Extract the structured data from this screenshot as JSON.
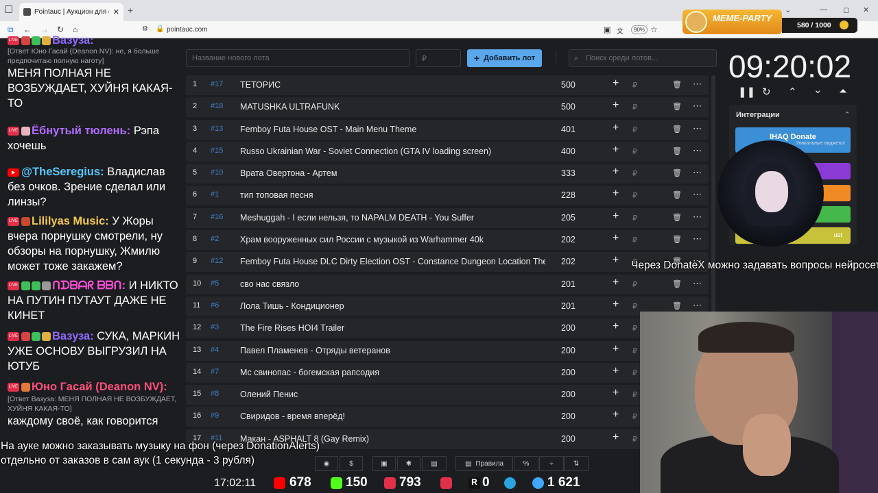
{
  "browser": {
    "tab_title": "Pointauc | Аукцион для стриме",
    "url": "pointauc.com",
    "zoom": "90%"
  },
  "toolbar": {
    "new_lot_placeholder": "Название нового лота",
    "currency_placeholder": "₽",
    "add_lot_label": "Добавить лот",
    "search_placeholder": "Поиск среди лотов..."
  },
  "lots": [
    {
      "index": "1",
      "id": "#17",
      "name": "ТЕТОРИС",
      "amount": "500"
    },
    {
      "index": "2",
      "id": "#18",
      "name": "MATUSHKA ULTRAFUNK",
      "amount": "500"
    },
    {
      "index": "3",
      "id": "#13",
      "name": "Femboy Futa House OST - Main Menu Theme",
      "amount": "401"
    },
    {
      "index": "4",
      "id": "#15",
      "name": "Russo Ukrainian War - Soviet Connection (GTA IV loading screen)",
      "amount": "400"
    },
    {
      "index": "5",
      "id": "#10",
      "name": "Врата Овертона - Артем",
      "amount": "333"
    },
    {
      "index": "6",
      "id": "#1",
      "name": "тип топовая песня",
      "amount": "228"
    },
    {
      "index": "7",
      "id": "#16",
      "name": "Meshuggah - I если нельзя, то NAPALM DEATH - You Suffer",
      "amount": "205"
    },
    {
      "index": "8",
      "id": "#2",
      "name": "Храм вооруженных сил России с музыкой из Warhammer 40k",
      "amount": "202"
    },
    {
      "index": "9",
      "id": "#12",
      "name": "Femboy Futa House DLC Dirty Election OST - Constance Dungeon Location The",
      "amount": "202"
    },
    {
      "index": "10",
      "id": "#5",
      "name": "сво нас связло",
      "amount": "201"
    },
    {
      "index": "11",
      "id": "#6",
      "name": "Лола Тишь - Кондиционер",
      "amount": "201"
    },
    {
      "index": "12",
      "id": "#3",
      "name": "The Fire Rises HOI4 Trailer",
      "amount": "200"
    },
    {
      "index": "13",
      "id": "#4",
      "name": "Павел Пламенев - Отряды ветеранов",
      "amount": "200"
    },
    {
      "index": "14",
      "id": "#7",
      "name": "Мс свинопас - богемская рапсодия",
      "amount": "200"
    },
    {
      "index": "15",
      "id": "#8",
      "name": "Олений Пенис",
      "amount": "200"
    },
    {
      "index": "16",
      "id": "#9",
      "name": "Свиридов - время вперёд!",
      "amount": "200"
    },
    {
      "index": "17",
      "id": "#11",
      "name": "Макан - ASPHALT 8 (Gay Remix)",
      "amount": "200"
    }
  ],
  "timer": {
    "value": "09:20:02"
  },
  "integrations": {
    "title": "Интеграции",
    "donate_label": "IHAQ Donate",
    "donate_sub": "Уникальные виджеты!",
    "extra_label": "uet"
  },
  "meme_party": {
    "title": "MEME-PARTY",
    "progress": "580 / 1000"
  },
  "chat": [
    {
      "user": "Вазуза:",
      "user_color": "#8d6bff",
      "text": ""
    },
    {
      "reply": "[Ответ Юно Гасай (Deanon NV): не, я больше предпочитаю полную наготу]",
      "text": "МЕНЯ ПОЛНАЯ НЕ ВОЗБУЖДАЕТ, ХУЙНЯ КАКАЯ-ТО"
    },
    {
      "user": "Ёбнутый тюлень:",
      "user_color": "#b06bff",
      "text": "Рэпа хочешь"
    },
    {
      "user": "@TheSeregius:",
      "user_color": "#55c8ff",
      "text": "Владислав без очков. Зрение сделал или линзы?"
    },
    {
      "user": "Lililyas Music:",
      "user_color": "#f2c94c",
      "text": "У Жоры вчера порнушку смотрели, ну обзоры на порнушку, Жмилю может тоже закажем?"
    },
    {
      "user": "ᑎᗪᗷᗩᖇ ᗷᗷᑎ:",
      "user_color": "#ff4fd8",
      "text": "И НИКТО НА ПУТИН ПУТАУТ ДАЖЕ НЕ КИНЕТ"
    },
    {
      "user": "Вазуза:",
      "user_color": "#8d6bff",
      "text": "СУКА, МАРКИН УЖЕ ОСНОВУ ВЫГРУЗИЛ НА ЮТУБ"
    },
    {
      "user": "Юно Гасай (Deanon NV):",
      "user_color": "#ff4f7b",
      "reply": "[Ответ Вазуза: МЕНЯ ПОЛНАЯ НЕ ВОЗБУЖДАЕТ, ХУЙНЯ КАКАЯ-ТО]",
      "text": "каждому своё, как говорится"
    }
  ],
  "subtitles": {
    "donatex": "Через DonateX можно задавать вопросы нейросети",
    "line1": "На ауке можно заказывать музыку на фон (через DonationAlerts)",
    "line2": "отдельно от заказов в сам аук (1 секунда - 3 рубля)"
  },
  "bottom_toolbar": {
    "rules_label": "Правила"
  },
  "stats": {
    "time": "17:02:11",
    "youtube": "678",
    "kick": "150",
    "vk": "793",
    "other": "",
    "rutube": "0",
    "total": "1 621"
  },
  "colors": {
    "accent": "#5ba7ec",
    "lot_id": "#3f7fc4"
  }
}
